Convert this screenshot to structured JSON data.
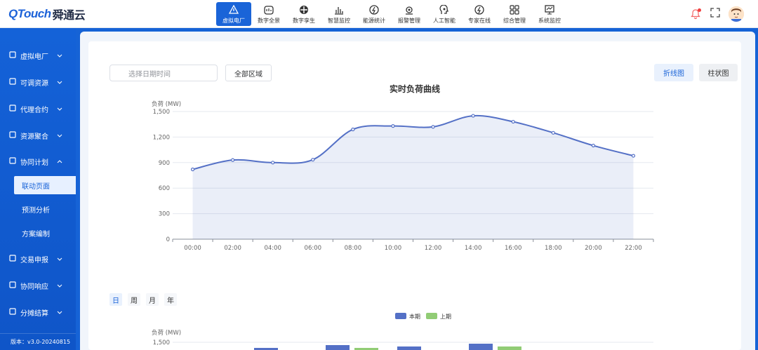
{
  "brand": {
    "logo_text": "QTouch",
    "logo_cn": "舜通云"
  },
  "nav": [
    {
      "label": "虚拟电厂",
      "icon": "power-plant-icon",
      "active": true
    },
    {
      "label": "数字全景",
      "icon": "digital-panorama-icon",
      "active": false
    },
    {
      "label": "数字孪生",
      "icon": "digital-twin-icon",
      "active": false
    },
    {
      "label": "智慧监控",
      "icon": "smart-monitor-icon",
      "active": false
    },
    {
      "label": "能源统计",
      "icon": "energy-stats-icon",
      "active": false
    },
    {
      "label": "报警管理",
      "icon": "alarm-icon",
      "active": false
    },
    {
      "label": "人工智能",
      "icon": "ai-icon",
      "active": false
    },
    {
      "label": "专家在线",
      "icon": "expert-icon",
      "active": false
    },
    {
      "label": "综合管理",
      "icon": "grid-manage-icon",
      "active": false
    },
    {
      "label": "系统监控",
      "icon": "system-monitor-icon",
      "active": false
    }
  ],
  "sidebar": {
    "items": [
      {
        "label": "虚拟电厂",
        "icon": "plant-icon",
        "expanded": false
      },
      {
        "label": "可调资源",
        "icon": "resource-icon",
        "expanded": false
      },
      {
        "label": "代理合约",
        "icon": "cart-icon",
        "expanded": false
      },
      {
        "label": "资源聚合",
        "icon": "aggregate-icon",
        "expanded": false
      },
      {
        "label": "协同计划",
        "icon": "plan-icon",
        "expanded": true
      },
      {
        "label": "交易申报",
        "icon": "trade-icon",
        "expanded": false
      },
      {
        "label": "协同响应",
        "icon": "response-icon",
        "expanded": false
      },
      {
        "label": "分摊结算",
        "icon": "settle-icon",
        "expanded": false
      }
    ],
    "sub_items": [
      {
        "label": "联动页面",
        "active": true
      },
      {
        "label": "预测分析",
        "active": false
      },
      {
        "label": "方案编制",
        "active": false
      }
    ],
    "version": "版本：v3.0-20240815"
  },
  "toolbar": {
    "date_placeholder": "选择日期时间",
    "region_label": "全部区域",
    "line_label": "折线图",
    "bar_label": "柱状图"
  },
  "period_tabs": [
    "日",
    "周",
    "月",
    "年"
  ],
  "colors": {
    "primary": "#1a64d8",
    "line": "#5470c6",
    "last_period": "#91cc75"
  },
  "chart_data": [
    {
      "type": "area",
      "title": "实时负荷曲线",
      "ylabel": "负荷 (MW)",
      "ylim": [
        0,
        1500
      ],
      "yticks": [
        "0",
        "300",
        "600",
        "900",
        "1,200",
        "1,500"
      ],
      "xticks": [
        "00:00",
        "02:00",
        "04:00",
        "06:00",
        "08:00",
        "10:00",
        "12:00",
        "14:00",
        "16:00",
        "18:00",
        "20:00",
        "22:00"
      ],
      "series": [
        {
          "x": [
            "00:00",
            "02:00",
            "04:00",
            "06:00",
            "08:00",
            "10:00",
            "12:00",
            "14:00",
            "16:00",
            "18:00",
            "20:00",
            "22:00"
          ],
          "values": [
            820,
            930,
            900,
            934,
            1290,
            1330,
            1320,
            1450,
            1380,
            1250,
            1100,
            980
          ]
        }
      ],
      "grid": true
    },
    {
      "type": "bar",
      "ylabel": "负荷 (MW)",
      "ytick_top": "1,500",
      "legend": [
        "本期",
        "上期"
      ],
      "legend_position": "top-center"
    }
  ]
}
